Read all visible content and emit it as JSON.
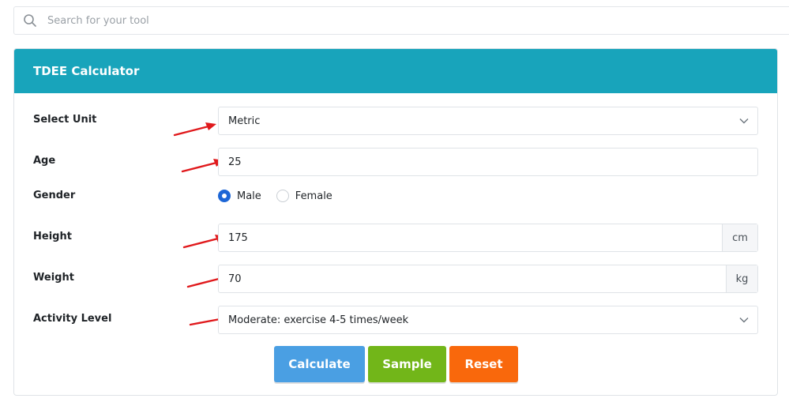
{
  "search": {
    "placeholder": "Search for your tool",
    "icon": "search-icon"
  },
  "card": {
    "title": "TDEE Calculator",
    "header_color": "#18a4bb"
  },
  "form": {
    "unit": {
      "label": "Select Unit",
      "value": "Metric"
    },
    "age": {
      "label": "Age",
      "value": "25"
    },
    "gender": {
      "label": "Gender",
      "options": [
        {
          "label": "Male",
          "checked": true
        },
        {
          "label": "Female",
          "checked": false
        }
      ]
    },
    "height": {
      "label": "Height",
      "value": "175",
      "unit": "cm"
    },
    "weight": {
      "label": "Weight",
      "value": "70",
      "unit": "kg"
    },
    "activity": {
      "label": "Activity Level",
      "value": "Moderate: exercise 4-5 times/week"
    }
  },
  "buttons": {
    "calculate": "Calculate",
    "sample": "Sample",
    "reset": "Reset"
  },
  "colors": {
    "calculate": "#4a9fe3",
    "sample": "#72b619",
    "reset": "#f9680c",
    "arrow": "#e0191c",
    "radio_checked": "#1d66d6"
  }
}
